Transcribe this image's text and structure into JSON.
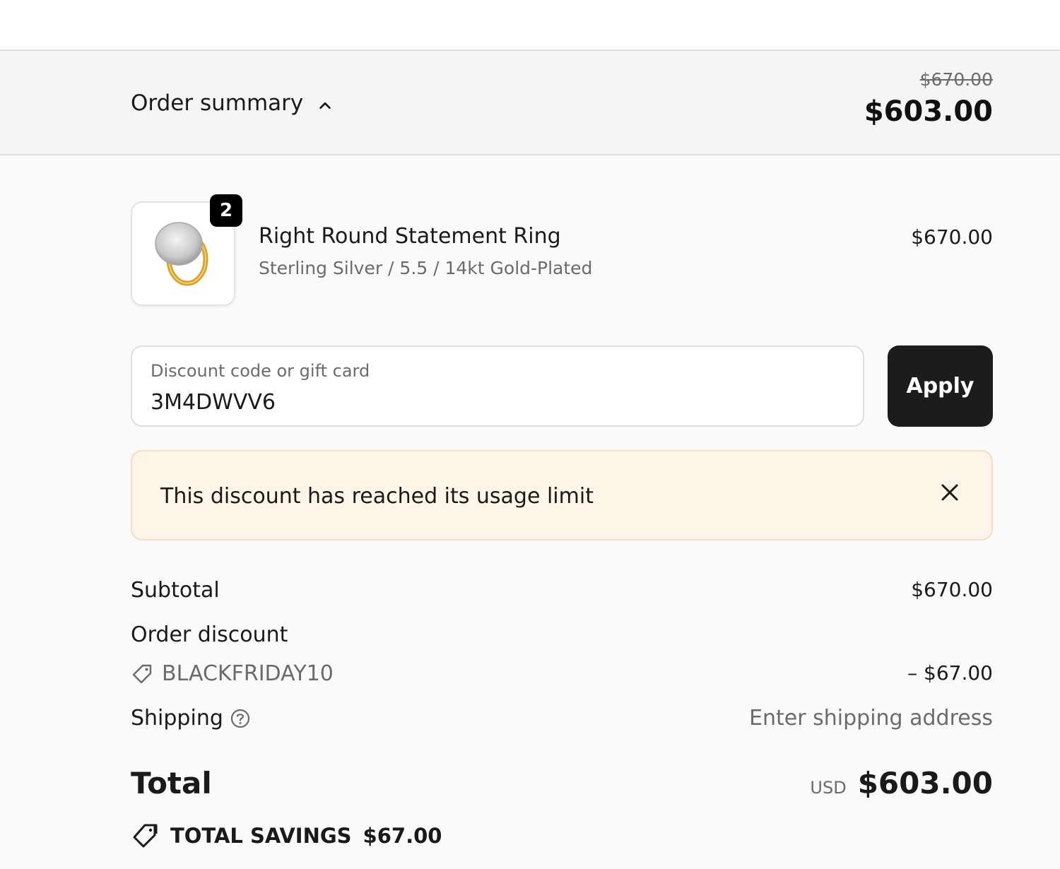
{
  "summary": {
    "toggle_label": "Order summary",
    "original_price": "$670.00",
    "discounted_price": "$603.00"
  },
  "product": {
    "quantity": "2",
    "name": "Right Round Statement Ring",
    "variant": "Sterling Silver / 5.5 / 14kt Gold-Plated",
    "price": "$670.00",
    "image_icon": "ring-image"
  },
  "discount": {
    "field_label": "Discount code or gift card",
    "field_value": "3M4DWVV6",
    "apply_label": "Apply",
    "error_message": "This discount has reached its usage limit"
  },
  "totals": {
    "subtotal_label": "Subtotal",
    "subtotal_value": "$670.00",
    "order_discount_label": "Order discount",
    "discount_code": "BLACKFRIDAY10",
    "discount_value": "– $67.00",
    "shipping_label": "Shipping",
    "shipping_value": "Enter shipping address",
    "total_label": "Total",
    "currency": "USD",
    "total_value": "$603.00",
    "savings_label": "TOTAL SAVINGS",
    "savings_value": "$67.00"
  },
  "colors": {
    "alert_bg": "#fff4e8",
    "button_bg": "#1c1c1c",
    "muted_text": "#6b6b6b"
  }
}
